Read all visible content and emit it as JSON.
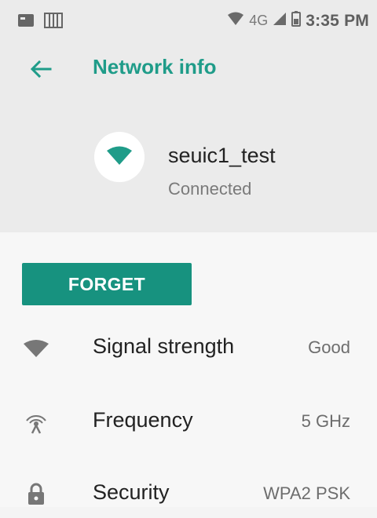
{
  "status_bar": {
    "network_type": "4G",
    "time": "3:35 PM",
    "icons": [
      "image-notification-icon",
      "storage-notification-icon",
      "wifi-status-icon",
      "cell-signal-icon",
      "battery-icon"
    ]
  },
  "header": {
    "title": "Network info"
  },
  "network": {
    "ssid": "seuic1_test",
    "status": "Connected"
  },
  "actions": {
    "forget_label": "FORGET"
  },
  "details": [
    {
      "label": "Signal strength",
      "value": "Good",
      "icon": "wifi-signal-icon"
    },
    {
      "label": "Frequency",
      "value": "5 GHz",
      "icon": "antenna-icon"
    },
    {
      "label": "Security",
      "value": "WPA2 PSK",
      "icon": "lock-icon"
    }
  ],
  "colors": {
    "accent": "#1f9c89",
    "button": "#17927f",
    "panel": "#ebebeb",
    "background": "#f7f7f7"
  }
}
